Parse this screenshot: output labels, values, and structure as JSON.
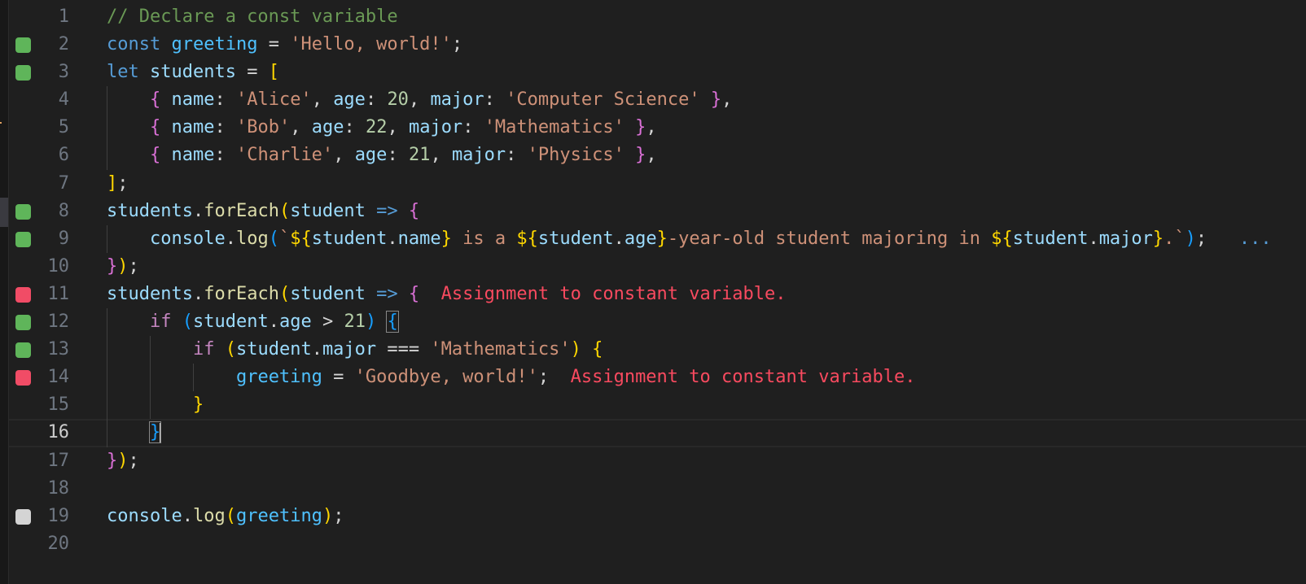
{
  "editor": {
    "current_line": 16,
    "lines": [
      {
        "n": "1",
        "badge": null,
        "tokens": [
          {
            "t": "// Declare a const variable",
            "c": "com"
          }
        ]
      },
      {
        "n": "2",
        "badge": "green",
        "tokens": [
          {
            "t": "const",
            "c": "kw"
          },
          {
            "t": " "
          },
          {
            "t": "greeting",
            "c": "const"
          },
          {
            "t": " = ",
            "c": "op"
          },
          {
            "t": "'Hello, world!'",
            "c": "str"
          },
          {
            "t": ";",
            "c": "op"
          }
        ]
      },
      {
        "n": "3",
        "badge": "green",
        "tokens": [
          {
            "t": "let",
            "c": "kw"
          },
          {
            "t": " "
          },
          {
            "t": "students",
            "c": "var"
          },
          {
            "t": " = ",
            "c": "op"
          },
          {
            "t": "[",
            "c": "p1"
          }
        ]
      },
      {
        "n": "4",
        "badge": null,
        "tokens": [
          {
            "t": "    "
          },
          {
            "t": "{",
            "c": "p2"
          },
          {
            "t": " "
          },
          {
            "t": "name",
            "c": "var"
          },
          {
            "t": ": ",
            "c": "op"
          },
          {
            "t": "'Alice'",
            "c": "str"
          },
          {
            "t": ", ",
            "c": "op"
          },
          {
            "t": "age",
            "c": "var"
          },
          {
            "t": ": ",
            "c": "op"
          },
          {
            "t": "20",
            "c": "num"
          },
          {
            "t": ", ",
            "c": "op"
          },
          {
            "t": "major",
            "c": "var"
          },
          {
            "t": ": ",
            "c": "op"
          },
          {
            "t": "'Computer Science'",
            "c": "str"
          },
          {
            "t": " "
          },
          {
            "t": "}",
            "c": "p2"
          },
          {
            "t": ",",
            "c": "op"
          }
        ]
      },
      {
        "n": "5",
        "badge": null,
        "tokens": [
          {
            "t": "    "
          },
          {
            "t": "{",
            "c": "p2"
          },
          {
            "t": " "
          },
          {
            "t": "name",
            "c": "var"
          },
          {
            "t": ": ",
            "c": "op"
          },
          {
            "t": "'Bob'",
            "c": "str"
          },
          {
            "t": ", ",
            "c": "op"
          },
          {
            "t": "age",
            "c": "var"
          },
          {
            "t": ": ",
            "c": "op"
          },
          {
            "t": "22",
            "c": "num"
          },
          {
            "t": ", ",
            "c": "op"
          },
          {
            "t": "major",
            "c": "var"
          },
          {
            "t": ": ",
            "c": "op"
          },
          {
            "t": "'Mathematics'",
            "c": "str"
          },
          {
            "t": " "
          },
          {
            "t": "}",
            "c": "p2"
          },
          {
            "t": ",",
            "c": "op"
          }
        ]
      },
      {
        "n": "6",
        "badge": null,
        "tokens": [
          {
            "t": "    "
          },
          {
            "t": "{",
            "c": "p2"
          },
          {
            "t": " "
          },
          {
            "t": "name",
            "c": "var"
          },
          {
            "t": ": ",
            "c": "op"
          },
          {
            "t": "'Charlie'",
            "c": "str"
          },
          {
            "t": ", ",
            "c": "op"
          },
          {
            "t": "age",
            "c": "var"
          },
          {
            "t": ": ",
            "c": "op"
          },
          {
            "t": "21",
            "c": "num"
          },
          {
            "t": ", ",
            "c": "op"
          },
          {
            "t": "major",
            "c": "var"
          },
          {
            "t": ": ",
            "c": "op"
          },
          {
            "t": "'Physics'",
            "c": "str"
          },
          {
            "t": " "
          },
          {
            "t": "}",
            "c": "p2"
          },
          {
            "t": ",",
            "c": "op"
          }
        ]
      },
      {
        "n": "7",
        "badge": null,
        "tokens": [
          {
            "t": "]",
            "c": "p1"
          },
          {
            "t": ";",
            "c": "op"
          }
        ]
      },
      {
        "n": "8",
        "badge": "green",
        "tokens": [
          {
            "t": "students",
            "c": "var"
          },
          {
            "t": ".",
            "c": "op"
          },
          {
            "t": "forEach",
            "c": "fn"
          },
          {
            "t": "(",
            "c": "p1"
          },
          {
            "t": "student",
            "c": "var"
          },
          {
            "t": " "
          },
          {
            "t": "=>",
            "c": "arrow"
          },
          {
            "t": " "
          },
          {
            "t": "{",
            "c": "p2"
          }
        ]
      },
      {
        "n": "9",
        "badge": "green",
        "tokens": [
          {
            "t": "    "
          },
          {
            "t": "console",
            "c": "var"
          },
          {
            "t": ".",
            "c": "op"
          },
          {
            "t": "log",
            "c": "fn"
          },
          {
            "t": "(",
            "c": "p3"
          },
          {
            "t": "`",
            "c": "str"
          },
          {
            "t": "${",
            "c": "p1"
          },
          {
            "t": "student",
            "c": "var"
          },
          {
            "t": ".",
            "c": "op"
          },
          {
            "t": "name",
            "c": "var"
          },
          {
            "t": "}",
            "c": "p1"
          },
          {
            "t": " is a ",
            "c": "str"
          },
          {
            "t": "${",
            "c": "p1"
          },
          {
            "t": "student",
            "c": "var"
          },
          {
            "t": ".",
            "c": "op"
          },
          {
            "t": "age",
            "c": "var"
          },
          {
            "t": "}",
            "c": "p1"
          },
          {
            "t": "-year-old student majoring in ",
            "c": "str"
          },
          {
            "t": "${",
            "c": "p1"
          },
          {
            "t": "student",
            "c": "var"
          },
          {
            "t": ".",
            "c": "op"
          },
          {
            "t": "major",
            "c": "var"
          },
          {
            "t": "}",
            "c": "p1"
          },
          {
            "t": ".`",
            "c": "str"
          },
          {
            "t": ")",
            "c": "p3"
          },
          {
            "t": ";",
            "c": "op"
          },
          {
            "t": "   "
          },
          {
            "t": "...",
            "c": "ell"
          }
        ]
      },
      {
        "n": "10",
        "badge": null,
        "tokens": [
          {
            "t": "}",
            "c": "p2"
          },
          {
            "t": ")",
            "c": "p1"
          },
          {
            "t": ";",
            "c": "op"
          }
        ]
      },
      {
        "n": "11",
        "badge": "red",
        "tokens": [
          {
            "t": "students",
            "c": "var"
          },
          {
            "t": ".",
            "c": "op"
          },
          {
            "t": "forEach",
            "c": "fn"
          },
          {
            "t": "(",
            "c": "p1"
          },
          {
            "t": "student",
            "c": "var"
          },
          {
            "t": " "
          },
          {
            "t": "=>",
            "c": "arrow"
          },
          {
            "t": " "
          },
          {
            "t": "{",
            "c": "p2"
          },
          {
            "t": "  "
          },
          {
            "t": "Assignment to constant variable.",
            "c": "err"
          }
        ]
      },
      {
        "n": "12",
        "badge": "green",
        "tokens": [
          {
            "t": "    "
          },
          {
            "t": "if",
            "c": "ctl"
          },
          {
            "t": " "
          },
          {
            "t": "(",
            "c": "p3"
          },
          {
            "t": "student",
            "c": "var"
          },
          {
            "t": ".",
            "c": "op"
          },
          {
            "t": "age",
            "c": "var"
          },
          {
            "t": " > ",
            "c": "op"
          },
          {
            "t": "21",
            "c": "num"
          },
          {
            "t": ")",
            "c": "p3"
          },
          {
            "t": " "
          },
          {
            "t": "{",
            "c": "p3",
            "match": true
          }
        ]
      },
      {
        "n": "13",
        "badge": "green",
        "tokens": [
          {
            "t": "        "
          },
          {
            "t": "if",
            "c": "ctl"
          },
          {
            "t": " "
          },
          {
            "t": "(",
            "c": "p1"
          },
          {
            "t": "student",
            "c": "var"
          },
          {
            "t": ".",
            "c": "op"
          },
          {
            "t": "major",
            "c": "var"
          },
          {
            "t": " === ",
            "c": "op"
          },
          {
            "t": "'Mathematics'",
            "c": "str"
          },
          {
            "t": ")",
            "c": "p1"
          },
          {
            "t": " "
          },
          {
            "t": "{",
            "c": "p1"
          }
        ]
      },
      {
        "n": "14",
        "badge": "red",
        "tokens": [
          {
            "t": "            "
          },
          {
            "t": "greeting",
            "c": "const"
          },
          {
            "t": " = ",
            "c": "op"
          },
          {
            "t": "'Goodbye, world!'",
            "c": "str"
          },
          {
            "t": ";",
            "c": "op"
          },
          {
            "t": "  "
          },
          {
            "t": "Assignment to constant variable.",
            "c": "err"
          }
        ]
      },
      {
        "n": "15",
        "badge": null,
        "tokens": [
          {
            "t": "        "
          },
          {
            "t": "}",
            "c": "p1"
          }
        ]
      },
      {
        "n": "16",
        "badge": null,
        "tokens": [
          {
            "t": "    "
          },
          {
            "t": "}",
            "c": "p3",
            "match": true,
            "cursor": true
          }
        ]
      },
      {
        "n": "17",
        "badge": null,
        "tokens": [
          {
            "t": "}",
            "c": "p2"
          },
          {
            "t": ")",
            "c": "p1"
          },
          {
            "t": ";",
            "c": "op"
          }
        ]
      },
      {
        "n": "18",
        "badge": null,
        "tokens": []
      },
      {
        "n": "19",
        "badge": "grey",
        "tokens": [
          {
            "t": "console",
            "c": "var"
          },
          {
            "t": ".",
            "c": "op"
          },
          {
            "t": "log",
            "c": "fn"
          },
          {
            "t": "(",
            "c": "p1"
          },
          {
            "t": "greeting",
            "c": "const"
          },
          {
            "t": ")",
            "c": "p1"
          },
          {
            "t": ";",
            "c": "op"
          }
        ]
      },
      {
        "n": "20",
        "badge": null,
        "tokens": []
      }
    ]
  }
}
